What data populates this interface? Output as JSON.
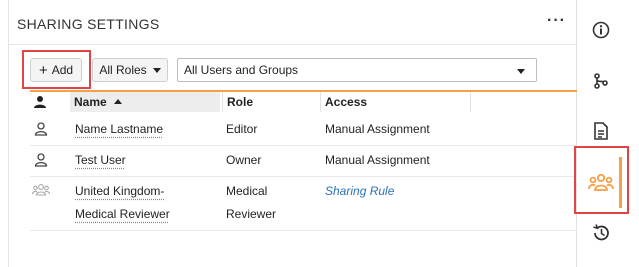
{
  "header": {
    "title": "SHARING SETTINGS",
    "more_label": "···"
  },
  "toolbar": {
    "add_label": "Add",
    "add_plus": "+",
    "roles_label": "All Roles",
    "filter_value": "All Users and Groups"
  },
  "table": {
    "columns": [
      "Name",
      "Role",
      "Access"
    ],
    "rows": [
      {
        "name": "Name Lastname",
        "role": "Editor",
        "access": "Manual Assignment",
        "type": "user"
      },
      {
        "name": "Test User",
        "role": "Owner",
        "access": "Manual Assignment",
        "type": "user"
      },
      {
        "name_line1": "United Kingdom-",
        "name_line2": "Medical Reviewer",
        "role_line1": "Medical",
        "role_line2": "Reviewer",
        "access": "Sharing Rule",
        "type": "group"
      }
    ]
  },
  "sidebar": {
    "items": [
      "info-icon",
      "branch-icon",
      "document-icon",
      "sharing-group-icon",
      "history-icon"
    ],
    "active": "sharing-group-icon"
  },
  "colors": {
    "accent": "#f5a046",
    "highlight": "#e04545",
    "link": "#2a72b5"
  }
}
